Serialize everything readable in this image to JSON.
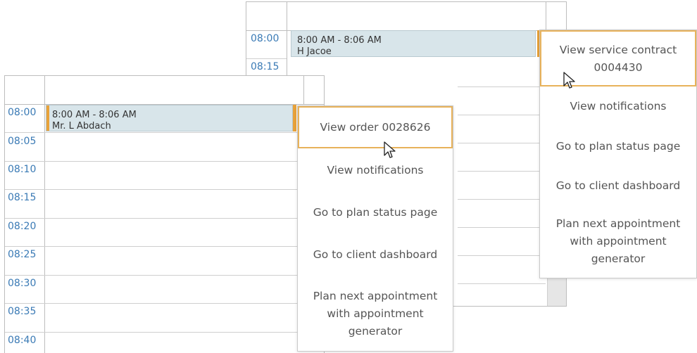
{
  "back_calendar": {
    "times": [
      "08:00",
      "08:15"
    ],
    "event": {
      "time_range": "8:00 AM - 8:06 AM",
      "name": "H Jacoe"
    },
    "menu": [
      {
        "label": "View service contract 0004430"
      },
      {
        "label": "View notifications"
      },
      {
        "label": "Go to plan status page"
      },
      {
        "label": "Go to client dashboard"
      },
      {
        "label": "Plan next appointment with appointment generator"
      }
    ]
  },
  "front_calendar": {
    "times": [
      "08:00",
      "08:05",
      "08:10",
      "08:15",
      "08:20",
      "08:25",
      "08:30",
      "08:35",
      "08:40"
    ],
    "event": {
      "time_range": "8:00 AM - 8:06 AM",
      "name": "Mr. L Abdach"
    },
    "menu": [
      {
        "label": "View order 0028626"
      },
      {
        "label": "View notifications"
      },
      {
        "label": "Go to plan status page"
      },
      {
        "label": "Go to client dashboard"
      },
      {
        "label": "Plan next appointment with appointment generator"
      }
    ]
  },
  "colors": {
    "accent": "#e8a23a",
    "event_bg": "#d8e5ea",
    "time_text": "#3a7ab5"
  }
}
